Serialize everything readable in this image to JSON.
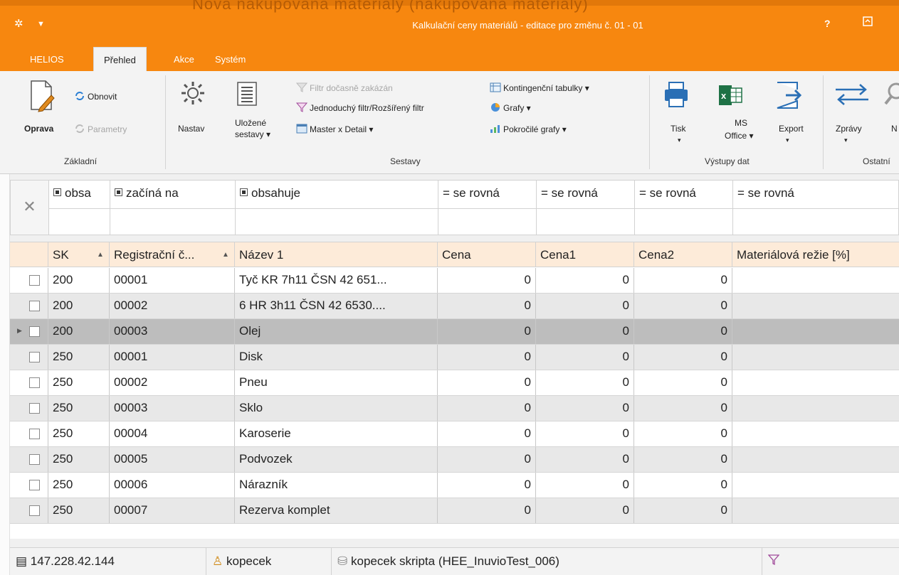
{
  "window": {
    "title": "Kalkulační ceny materiálů - editace pro změnu č. 01 - 01",
    "help_label": "?",
    "background_heading": "Nová nakupovaná materiály (nakupovaná materiály)"
  },
  "ribbon_tabs": [
    "HELIOS",
    "Přehled",
    "Akce",
    "Systém"
  ],
  "ribbon": {
    "zakladni": {
      "label": "Základní",
      "oprava": "Oprava",
      "obnovit": "Obnovit",
      "parametry": "Parametry"
    },
    "sestavy": {
      "label": "Sestavy",
      "nastav": "Nastav",
      "ulozene": "Uložené",
      "sestavy_dd": "sestavy ▾",
      "filtr_zakazan": "Filtr dočasně zakázán",
      "jednoduchy_filtr": "Jednoduchý filtr/Rozšířený filtr",
      "master_detail": "Master x Detail ▾",
      "kontingencni": "Kontingenční tabulky ▾",
      "grafy": "Grafy ▾",
      "pokrocile_grafy": "Pokročilé grafy ▾"
    },
    "vystupy": {
      "label": "Výstupy dat",
      "tisk": "Tisk",
      "tisk_dd": "▾",
      "ms": "MS",
      "office": "Office ▾",
      "export": "Export",
      "export_dd": "▾"
    },
    "ostatni": {
      "label": "Ostatní",
      "zpravy": "Zprávy",
      "zpravy_dd": "▾",
      "n": "N"
    }
  },
  "filter_ops": [
    "obsa",
    "začíná na",
    "obsahuje",
    "= se rovná",
    "= se rovná",
    "= se rovná",
    "= se rovná"
  ],
  "columns": [
    "SK",
    "Registrační č...",
    "Název 1",
    "Cena",
    "Cena1",
    "Cena2",
    "Materiálová režie [%]"
  ],
  "rows": [
    {
      "sk": "200",
      "reg": "00001",
      "nazev": "Tyč KR 7h11 ČSN 42 651...",
      "cena": "0",
      "cena1": "0",
      "cena2": "0",
      "rezie": ""
    },
    {
      "sk": "200",
      "reg": "00002",
      "nazev": "6 HR 3h11 ČSN 42 6530....",
      "cena": "0",
      "cena1": "0",
      "cena2": "0",
      "rezie": ""
    },
    {
      "sk": "200",
      "reg": "00003",
      "nazev": "Olej",
      "cena": "0",
      "cena1": "0",
      "cena2": "0",
      "rezie": ""
    },
    {
      "sk": "250",
      "reg": "00001",
      "nazev": "Disk",
      "cena": "0",
      "cena1": "0",
      "cena2": "0",
      "rezie": ""
    },
    {
      "sk": "250",
      "reg": "00002",
      "nazev": "Pneu",
      "cena": "0",
      "cena1": "0",
      "cena2": "0",
      "rezie": ""
    },
    {
      "sk": "250",
      "reg": "00003",
      "nazev": "Sklo",
      "cena": "0",
      "cena1": "0",
      "cena2": "0",
      "rezie": ""
    },
    {
      "sk": "250",
      "reg": "00004",
      "nazev": "Karoserie",
      "cena": "0",
      "cena1": "0",
      "cena2": "0",
      "rezie": ""
    },
    {
      "sk": "250",
      "reg": "00005",
      "nazev": "Podvozek",
      "cena": "0",
      "cena1": "0",
      "cena2": "0",
      "rezie": ""
    },
    {
      "sk": "250",
      "reg": "00006",
      "nazev": "Nárazník",
      "cena": "0",
      "cena1": "0",
      "cena2": "0",
      "rezie": ""
    },
    {
      "sk": "250",
      "reg": "00007",
      "nazev": "Rezerva komplet",
      "cena": "0",
      "cena1": "0",
      "cena2": "0",
      "rezie": ""
    }
  ],
  "selected_row": 2,
  "statusbar": {
    "server": "147.228.42.144",
    "user": "kopecek",
    "database": "kopecek skripta (HEE_InuvioTest_006)"
  },
  "colors": {
    "accent": "#f7870f",
    "header_bg": "#fdebd9",
    "row_alt": "#e8e8e8",
    "row_selected": "#bdbdbd"
  }
}
